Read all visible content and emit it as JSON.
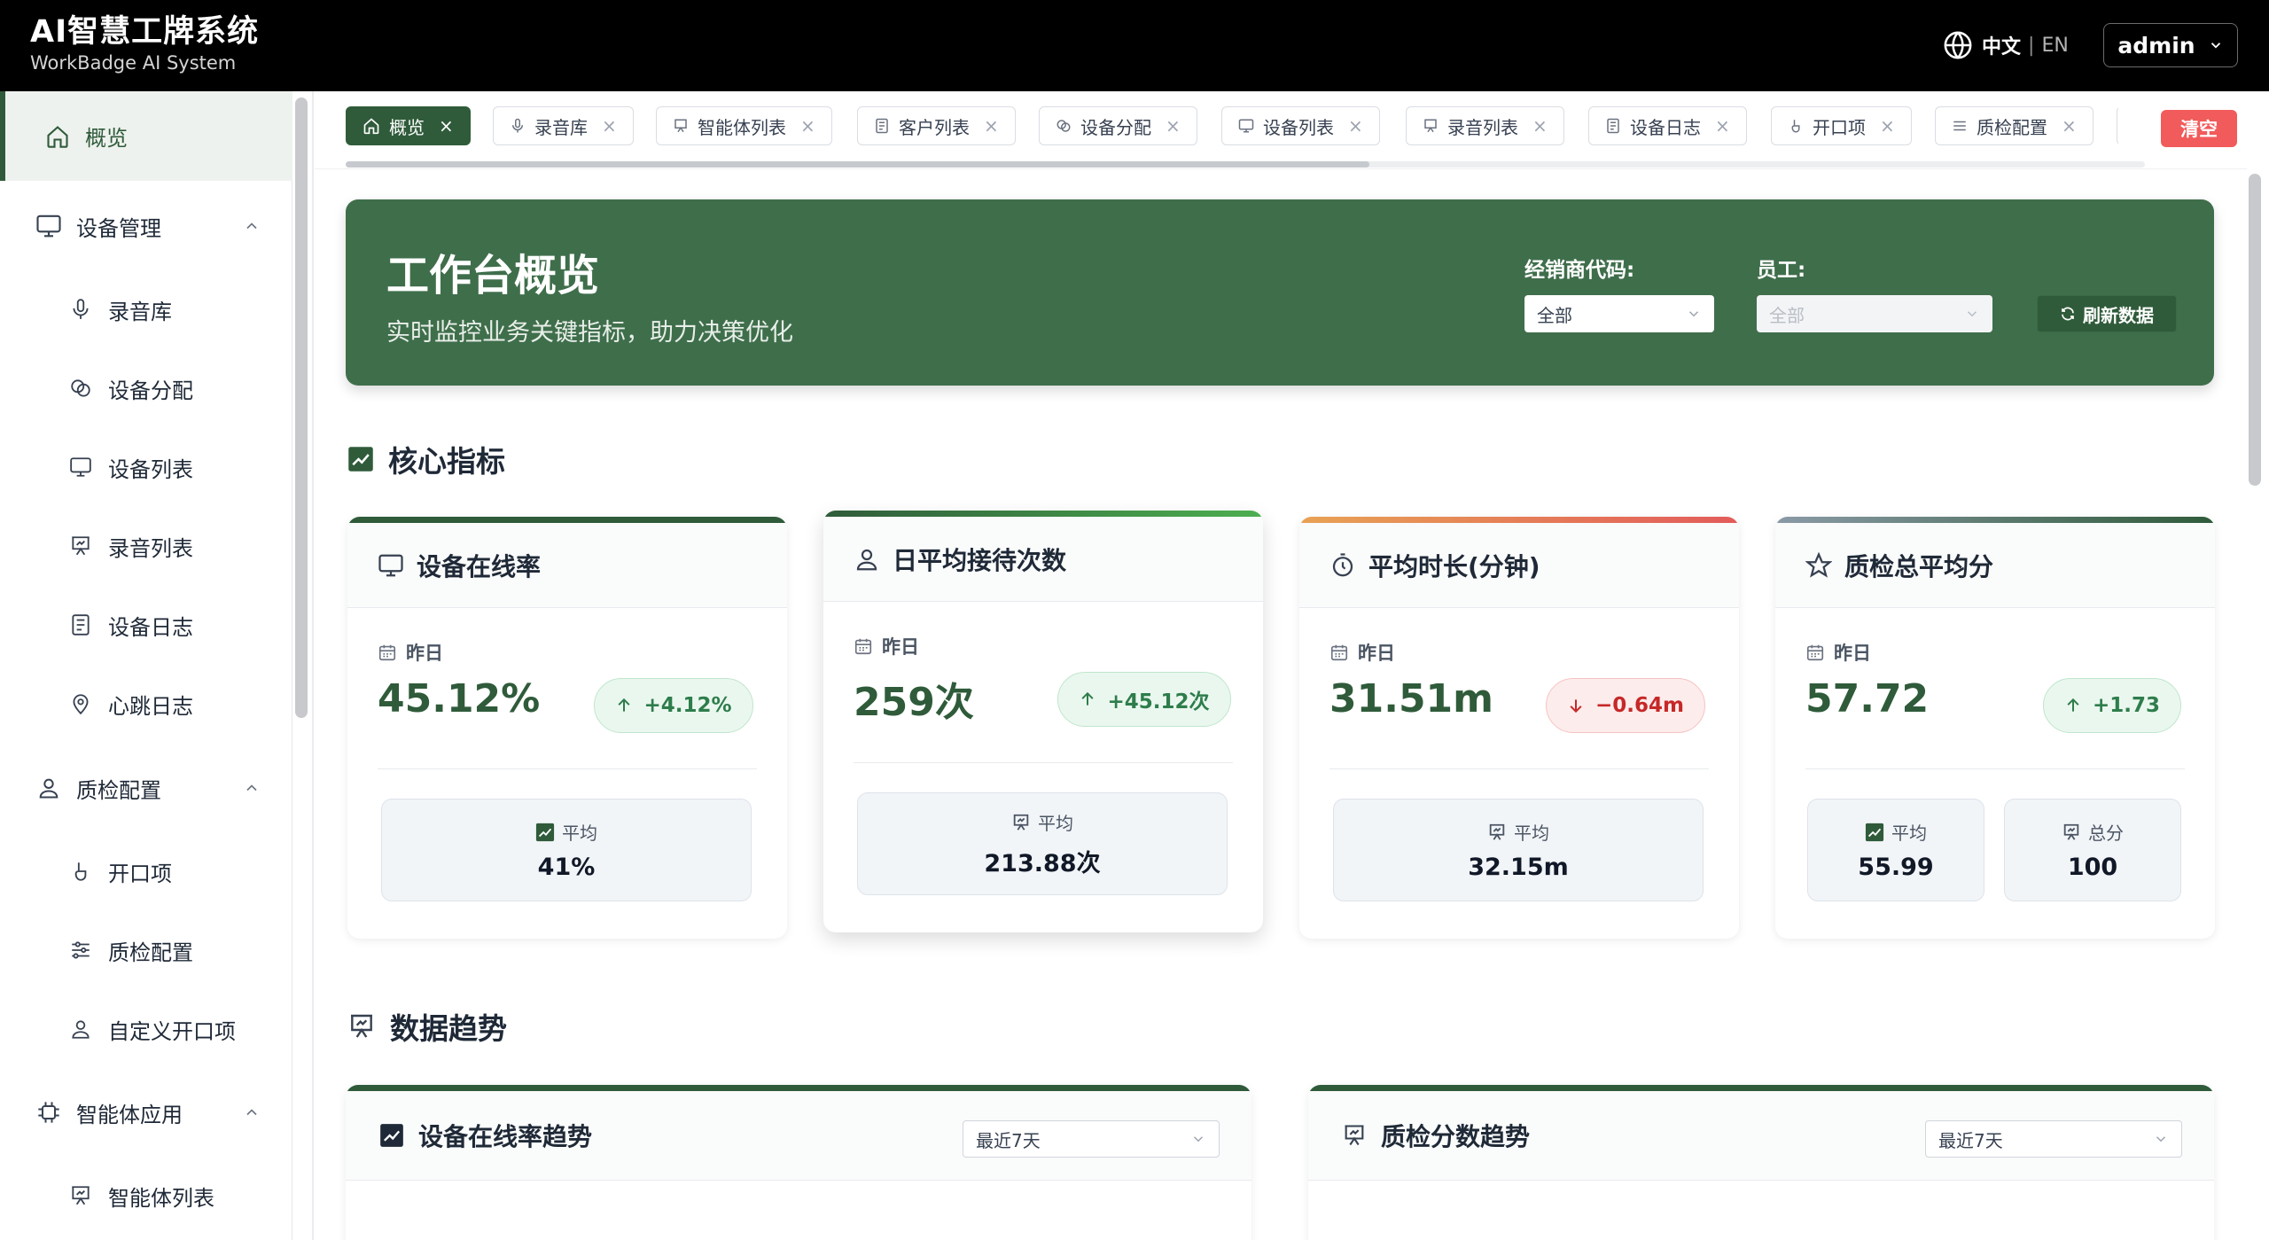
{
  "app": {
    "title": "AI智慧工牌系统",
    "subtitle": "WorkBadge AI System",
    "lang_zh": "中文",
    "lang_sep": "|",
    "lang_en": "EN",
    "user": "admin"
  },
  "sidebar": {
    "items": [
      {
        "label": "概览",
        "icon": "home-icon"
      },
      {
        "label": "设备管理",
        "icon": "monitor-icon"
      },
      {
        "label": "录音库",
        "icon": "microphone-icon"
      },
      {
        "label": "设备分配",
        "icon": "link-icon"
      },
      {
        "label": "设备列表",
        "icon": "monitor-icon"
      },
      {
        "label": "录音列表",
        "icon": "presentation-icon"
      },
      {
        "label": "设备日志",
        "icon": "document-icon"
      },
      {
        "label": "心跳日志",
        "icon": "location-pin-icon"
      },
      {
        "label": "质检配置",
        "icon": "user-icon"
      },
      {
        "label": "开口项",
        "icon": "hand-icon"
      },
      {
        "label": "质检配置",
        "icon": "sliders-icon"
      },
      {
        "label": "自定义开口项",
        "icon": "user-icon"
      },
      {
        "label": "智能体应用",
        "icon": "chip-icon"
      },
      {
        "label": "智能体列表",
        "icon": "presentation-icon"
      }
    ]
  },
  "tabs": {
    "items": [
      {
        "label": "概览",
        "icon": "home-icon"
      },
      {
        "label": "录音库",
        "icon": "microphone-icon"
      },
      {
        "label": "智能体列表",
        "icon": "presentation-icon"
      },
      {
        "label": "客户列表",
        "icon": "document-icon"
      },
      {
        "label": "设备分配",
        "icon": "link-icon"
      },
      {
        "label": "设备列表",
        "icon": "monitor-icon"
      },
      {
        "label": "录音列表",
        "icon": "presentation-icon"
      },
      {
        "label": "设备日志",
        "icon": "document-icon"
      },
      {
        "label": "开口项",
        "icon": "hand-icon"
      },
      {
        "label": "质检配置",
        "icon": "sliders-icon"
      }
    ],
    "close": "×",
    "clear": "清空"
  },
  "hero": {
    "title": "工作台概览",
    "subtitle": "实时监控业务关键指标，助力决策优化",
    "dealer_label": "经销商代码:",
    "dealer_value": "全部",
    "staff_label": "员工:",
    "staff_value": "全部",
    "refresh": "刷新数据"
  },
  "sections": {
    "core": "核心指标",
    "trend": "数据趋势"
  },
  "kpis": [
    {
      "title": "设备在线率",
      "period": "昨日",
      "value": "45.12%",
      "change": "+4.12%",
      "dir": "up",
      "stats": [
        {
          "label": "平均",
          "value": "41%"
        }
      ]
    },
    {
      "title": "日平均接待次数",
      "period": "昨日",
      "value": "259次",
      "change": "+45.12次",
      "dir": "up",
      "stats": [
        {
          "label": "平均",
          "value": "213.88次"
        }
      ]
    },
    {
      "title": "平均时长(分钟)",
      "period": "昨日",
      "value": "31.51m",
      "change": "−0.64m",
      "dir": "down",
      "stats": [
        {
          "label": "平均",
          "value": "32.15m"
        }
      ]
    },
    {
      "title": "质检总平均分",
      "period": "昨日",
      "value": "57.72",
      "change": "+1.73",
      "dir": "up",
      "stats": [
        {
          "label": "平均",
          "value": "55.99"
        },
        {
          "label": "总分",
          "value": "100"
        }
      ]
    }
  ],
  "trends": [
    {
      "title": "设备在线率趋势",
      "range": "最近7天"
    },
    {
      "title": "质检分数趋势",
      "range": "最近7天"
    }
  ],
  "colors": {
    "brand_green": "#2f5b3a",
    "hero_green": "#3f6e4b",
    "danger": "#f15b5b"
  }
}
